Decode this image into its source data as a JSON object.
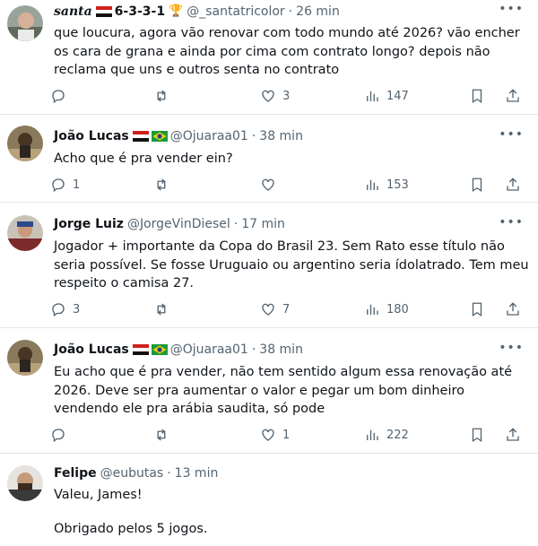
{
  "tweets": [
    {
      "name": "santa",
      "name_suffix": "6-3-3-1",
      "handle": "@_santatricolor",
      "time": "26 min",
      "text": "que loucura, agora vão renovar com todo mundo até 2026? vão encher os cara de grana e ainda por cima com contrato longo? depois não reclama que uns e outros senta no contrato",
      "replies": "",
      "retweets": "",
      "likes": "3",
      "views": "147"
    },
    {
      "name": "João Lucas",
      "handle": "@Ojuaraa01",
      "time": "38 min",
      "text": "Acho que é pra vender ein?",
      "replies": "1",
      "retweets": "",
      "likes": "",
      "views": "153"
    },
    {
      "name": "Jorge Luiz",
      "handle": "@JorgeVinDiesel",
      "time": "17 min",
      "text": "Jogador + importante da Copa do Brasil 23. Sem Rato esse título não seria possível. Se fosse Uruguaio ou argentino seria ídolatrado. Tem meu respeito o camisa 27.",
      "replies": "3",
      "retweets": "",
      "likes": "7",
      "views": "180"
    },
    {
      "name": "João Lucas",
      "handle": "@Ojuaraa01",
      "time": "38 min",
      "text": "Eu acho que é pra vender, não tem sentido algum essa renovação até 2026. Deve ser pra aumentar o valor e pegar um bom dinheiro vendendo ele pra arábia saudita, só pode",
      "replies": "",
      "retweets": "",
      "likes": "1",
      "views": "222"
    },
    {
      "name": "Felipe",
      "handle": "@eubutas",
      "time": "13 min",
      "text": "Valeu, James!\n\nObrigado pelos 5 jogos.",
      "replies": "",
      "retweets": "",
      "likes": "",
      "views": ""
    }
  ],
  "icons": {
    "reply": "reply-icon",
    "retweet": "retweet-icon",
    "like": "heart-icon",
    "views": "views-icon",
    "bookmark": "bookmark-icon",
    "share": "share-icon"
  },
  "colors": {
    "text": "#0f1419",
    "muted": "#536471",
    "divider": "#e3e6e8"
  }
}
